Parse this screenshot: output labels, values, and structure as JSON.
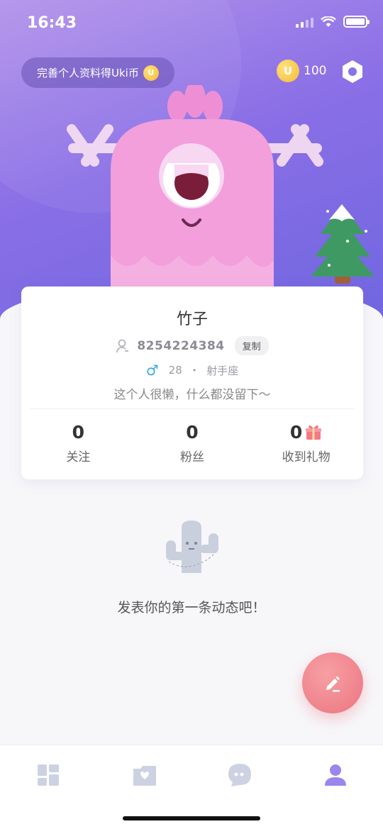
{
  "status_bar": {
    "time": "16:43"
  },
  "header": {
    "promo_text": "完善个人资料得Uki币",
    "coin_badge": "U",
    "coin_balance": "100"
  },
  "profile": {
    "nickname": "竹子",
    "user_id": "8254224384",
    "copy_label": "复制",
    "gender_symbol": "♂",
    "age": "28",
    "separator": "•",
    "zodiac": "射手座",
    "bio": "这个人很懒，什么都没留下～"
  },
  "stats": [
    {
      "value": "0",
      "label": "关注"
    },
    {
      "value": "0",
      "label": "粉丝"
    },
    {
      "value": "0",
      "label": "收到礼物"
    }
  ],
  "empty_state": {
    "text": "发表你的第一条动态吧！"
  },
  "tabbar": {
    "items": [
      "grid-icon",
      "photo-folder-icon",
      "chat-bubble-icon",
      "person-icon"
    ],
    "active_index": 3
  },
  "colors": {
    "accent": "#8a6fe6",
    "fab": "#ec7480",
    "gender": "#37a9e5",
    "active_tab": "#9a86ec",
    "inactive_tab": "#cdd2e3"
  }
}
